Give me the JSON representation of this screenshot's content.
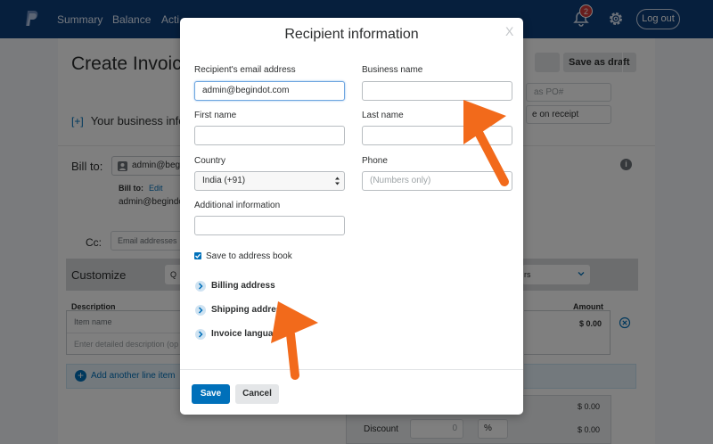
{
  "nav": {
    "items": [
      "Summary",
      "Balance",
      "Acti"
    ],
    "notifications_count": "2",
    "logout_label": "Log out"
  },
  "background": {
    "page_title": "Create Invoic",
    "save_draft_label": "Save as draft",
    "po_placeholder": "as PO#",
    "receipt_value": "e on receipt",
    "your_business": "Your business infor",
    "bill_to_label": "Bill to:",
    "bill_chip": "admin@begin",
    "bill_to_small": "Bill to:",
    "edit_link": "Edit",
    "bill_to_email": "admin@begindot",
    "cc_label": "Cc:",
    "cc_placeholder": "Email addresses",
    "customize_label": "Customize",
    "customize_select1": "Q",
    "customize_select2": "rs",
    "description_header": "Description",
    "amount_header": "Amount",
    "item_name_placeholder": "Item name",
    "item_desc_placeholder": "Enter detailed description (op",
    "amount_value": "$ 0.00",
    "add_line_label": "Add another line item",
    "subtotal_value": "$ 0.00",
    "discount_label": "Discount",
    "discount_value": "0",
    "discount_unit": "%",
    "discount_amount": "$ 0.00"
  },
  "modal": {
    "title": "Recipient information",
    "close_label": "X",
    "email_label": "Recipient's email address",
    "email_value": "admin@begindot.com",
    "business_label": "Business name",
    "business_value": "",
    "first_name_label": "First name",
    "first_name_value": "",
    "last_name_label": "Last name",
    "last_name_value": "",
    "country_label": "Country",
    "country_value": "India (+91)",
    "phone_label": "Phone",
    "phone_placeholder": "(Numbers only)",
    "additional_label": "Additional information",
    "additional_value": "",
    "save_address_label": "Save to address book",
    "save_address_checked": true,
    "sections": [
      "Billing address",
      "Shipping address",
      "Invoice language"
    ],
    "save_label": "Save",
    "cancel_label": "Cancel"
  },
  "colors": {
    "nav_bg": "#0d3f7a",
    "primary": "#0070ba",
    "annotation_arrow": "#f26a1b",
    "badge": "#d13b3b"
  },
  "icons": [
    "paypal-logo-icon",
    "bell-icon",
    "gear-icon",
    "person-icon",
    "info-icon",
    "remove-circle-icon",
    "add-circle-icon",
    "chevron-right-icon",
    "checkmark-icon"
  ]
}
